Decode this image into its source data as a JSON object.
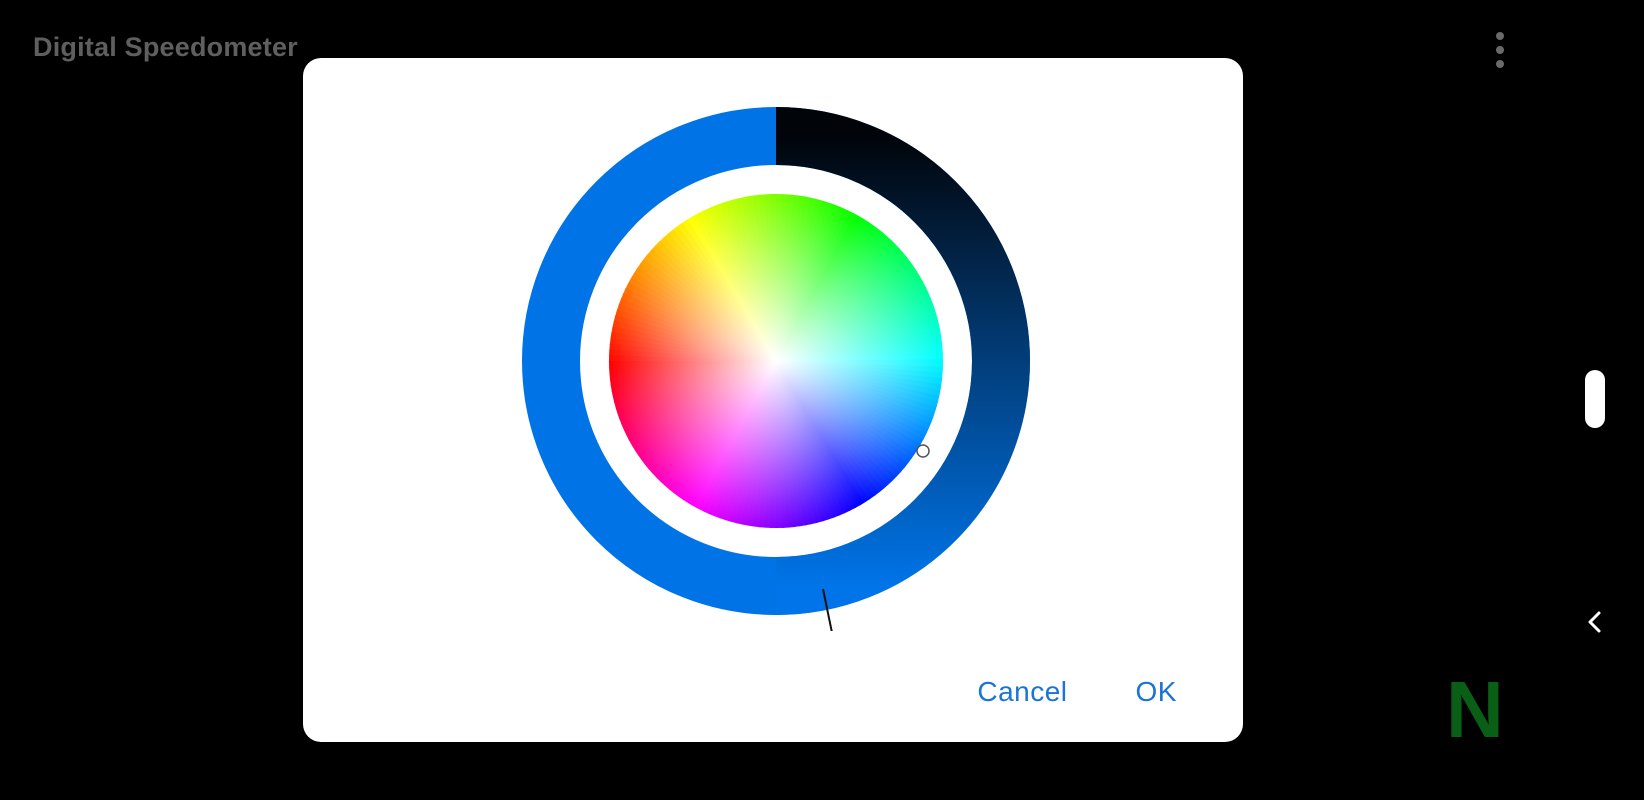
{
  "app": {
    "title": "Digital Speedometer"
  },
  "compass": {
    "heading": "N",
    "color": "#0a5f16"
  },
  "dialog": {
    "cancel_label": "Cancel",
    "ok_label": "OK"
  },
  "color_picker": {
    "selected_color": "#0073e6",
    "ring_dark_color": "#010409"
  },
  "icons": {
    "menu": "more-vert-icon",
    "back": "chevron-left-icon"
  }
}
